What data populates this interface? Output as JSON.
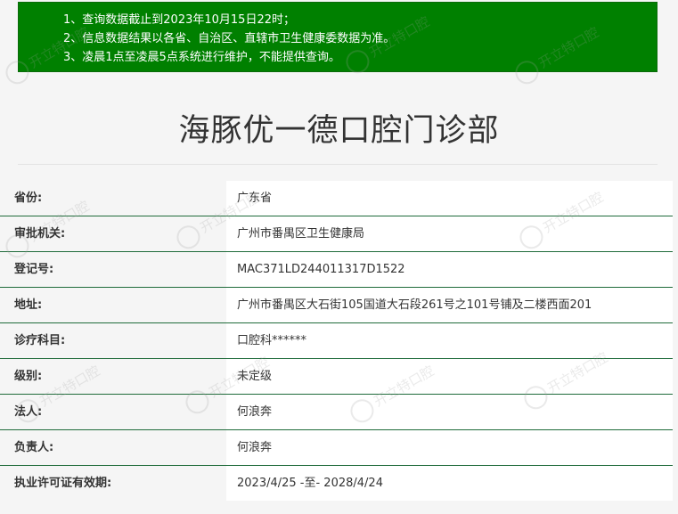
{
  "notice": {
    "lines": [
      "1、查询数据截止到2023年10月15日22时；",
      "2、信息数据结果以各省、自治区、直辖市卫生健康委数据为准。",
      "3、凌晨1点至凌晨5点系统进行维护，不能提供查询。"
    ]
  },
  "page_title": "海豚优一德口腔门诊部",
  "watermark_text": "开立特口腔",
  "colors": {
    "notice_bg": "#008000",
    "row_border": "#1f6b3a"
  },
  "rows": [
    {
      "label": "省份:",
      "value": "广东省"
    },
    {
      "label": "审批机关:",
      "value": "广州市番禺区卫生健康局"
    },
    {
      "label": "登记号:",
      "value": "MAC371LD244011317D1522"
    },
    {
      "label": "地址:",
      "value": "广州市番禺区大石街105国道大石段261号之101号铺及二楼西面201"
    },
    {
      "label": "诊疗科目:",
      "value": "口腔科******"
    },
    {
      "label": "级别:",
      "value": "未定级"
    },
    {
      "label": "法人:",
      "value": "何浪奔"
    },
    {
      "label": "负责人:",
      "value": "何浪奔"
    },
    {
      "label": "执业许可证有效期:",
      "value": "2023/4/25 -至- 2028/4/24"
    }
  ]
}
